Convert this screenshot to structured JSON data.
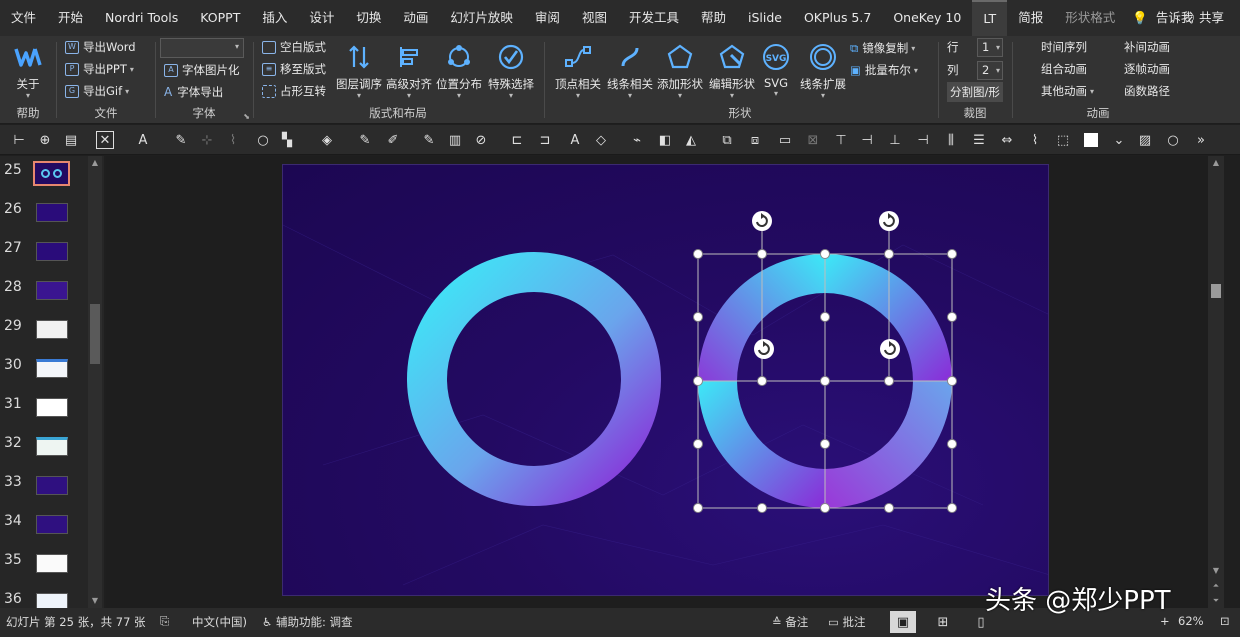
{
  "menu": {
    "tabs": [
      "文件",
      "开始",
      "Nordri Tools",
      "KOPPT",
      "插入",
      "设计",
      "切换",
      "动画",
      "幻灯片放映",
      "审阅",
      "视图",
      "开发工具",
      "帮助",
      "iSlide",
      "OKPlus 5.7",
      "OneKey 10",
      "LT",
      "简报",
      "形状格式"
    ],
    "active_tab": "LT",
    "tell_me": "告诉我",
    "share": "共享"
  },
  "ribbon": {
    "help_group": {
      "title": "帮助",
      "about": "关于"
    },
    "file_group": {
      "title": "文件",
      "export_word": "导出Word",
      "export_ppt": "导出PPT",
      "export_gif": "导出Gif"
    },
    "font_group": {
      "title": "字体",
      "font_to_image": "字体图片化",
      "font_export": "字体导出"
    },
    "layout_group": {
      "title": "版式和布局",
      "blank_layout": "空白版式",
      "move_layout": "移至版式",
      "placeholder_swap": "占形互转",
      "layer_order": "图层调序",
      "adv_align": "高级对齐",
      "position_dist": "位置分布",
      "special_select": "特殊选择"
    },
    "shape_group": {
      "title": "形状",
      "vertex": "顶点相关",
      "line": "线条相关",
      "add_shape": "添加形状",
      "edit_shape": "编辑形状",
      "svg": "SVG",
      "line_extend": "线条扩展",
      "mirror_copy": "镜像复制",
      "batch_boolean": "批量布尔"
    },
    "crop_group": {
      "title": "裁图",
      "row_label": "行",
      "row_value": "1",
      "col_label": "列",
      "col_value": "2",
      "split": "分割图/形"
    },
    "anim_group": {
      "title": "动画",
      "timeline": "时间序列",
      "tween": "补间动画",
      "combo": "组合动画",
      "frame": "逐帧动画",
      "other": "其他动画",
      "func_path": "函数路径"
    }
  },
  "thumbnails": [
    {
      "num": "25",
      "selected": true
    },
    {
      "num": "26"
    },
    {
      "num": "27"
    },
    {
      "num": "28"
    },
    {
      "num": "29"
    },
    {
      "num": "30"
    },
    {
      "num": "31"
    },
    {
      "num": "32"
    },
    {
      "num": "33"
    },
    {
      "num": "34"
    },
    {
      "num": "35"
    },
    {
      "num": "36"
    }
  ],
  "status": {
    "slide_info": "幻灯片 第 25 张，共 77 张",
    "language": "中文(中国)",
    "accessibility": "辅助功能: 调查",
    "notes": "备注",
    "comments": "批注",
    "zoom": "62%"
  },
  "watermark": "头条 @郑少PPT",
  "colors": {
    "ring_start": "#3ce9f7",
    "ring_end": "#8a2bd8",
    "slide_bg": "#230a62",
    "accent_sel": "#e7876f"
  }
}
